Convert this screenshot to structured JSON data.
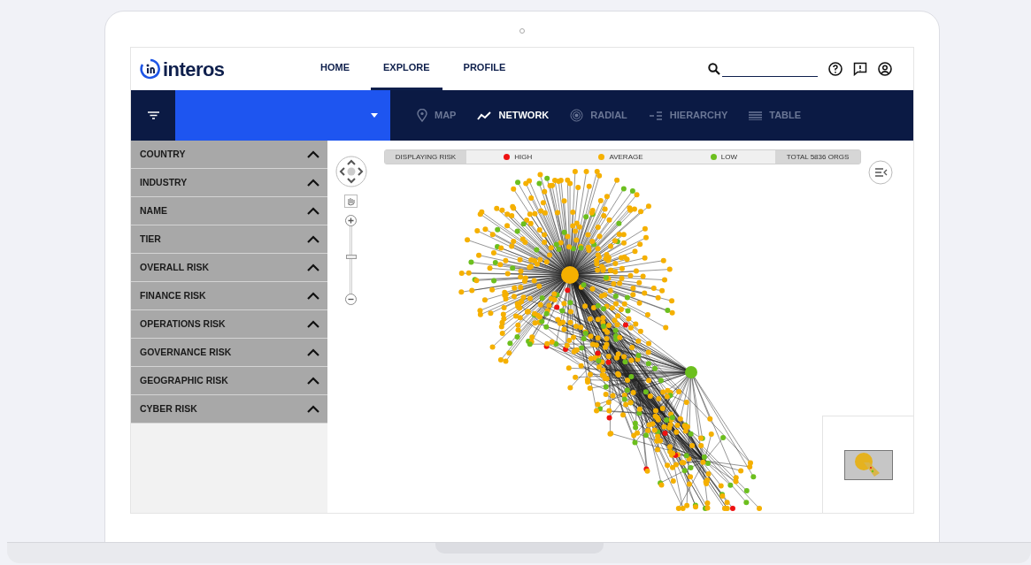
{
  "logo": {
    "text": "interos"
  },
  "nav": [
    {
      "label": "HOME",
      "selected": false
    },
    {
      "label": "EXPLORE",
      "selected": true
    },
    {
      "label": "PROFILE",
      "selected": false
    }
  ],
  "views": [
    {
      "label": "MAP",
      "kind": "map",
      "selected": false
    },
    {
      "label": "NETWORK",
      "kind": "network",
      "selected": true
    },
    {
      "label": "RADIAL",
      "kind": "radial",
      "selected": false
    },
    {
      "label": "HIERARCHY",
      "kind": "hierarchy",
      "selected": false
    },
    {
      "label": "TABLE",
      "kind": "table",
      "selected": false
    }
  ],
  "zoom": {
    "level": 0.55
  },
  "filters": [
    "COUNTRY",
    "INDUSTRY",
    "NAME",
    "TIER",
    "OVERALL RISK",
    "FINANCE RISK",
    "OPERATIONS RISK",
    "GOVERNANCE RISK",
    "GEOGRAPHIC RISK",
    "CYBER RISK"
  ],
  "legend": {
    "title": "DISPLAYING RISK",
    "items": [
      {
        "label": "HIGH",
        "color": "#ee1111"
      },
      {
        "label": "AVERAGE",
        "color": "#f5b000"
      },
      {
        "label": "LOW",
        "color": "#6cbf1e"
      }
    ],
    "total": "TOTAL 5836 ORGS"
  }
}
